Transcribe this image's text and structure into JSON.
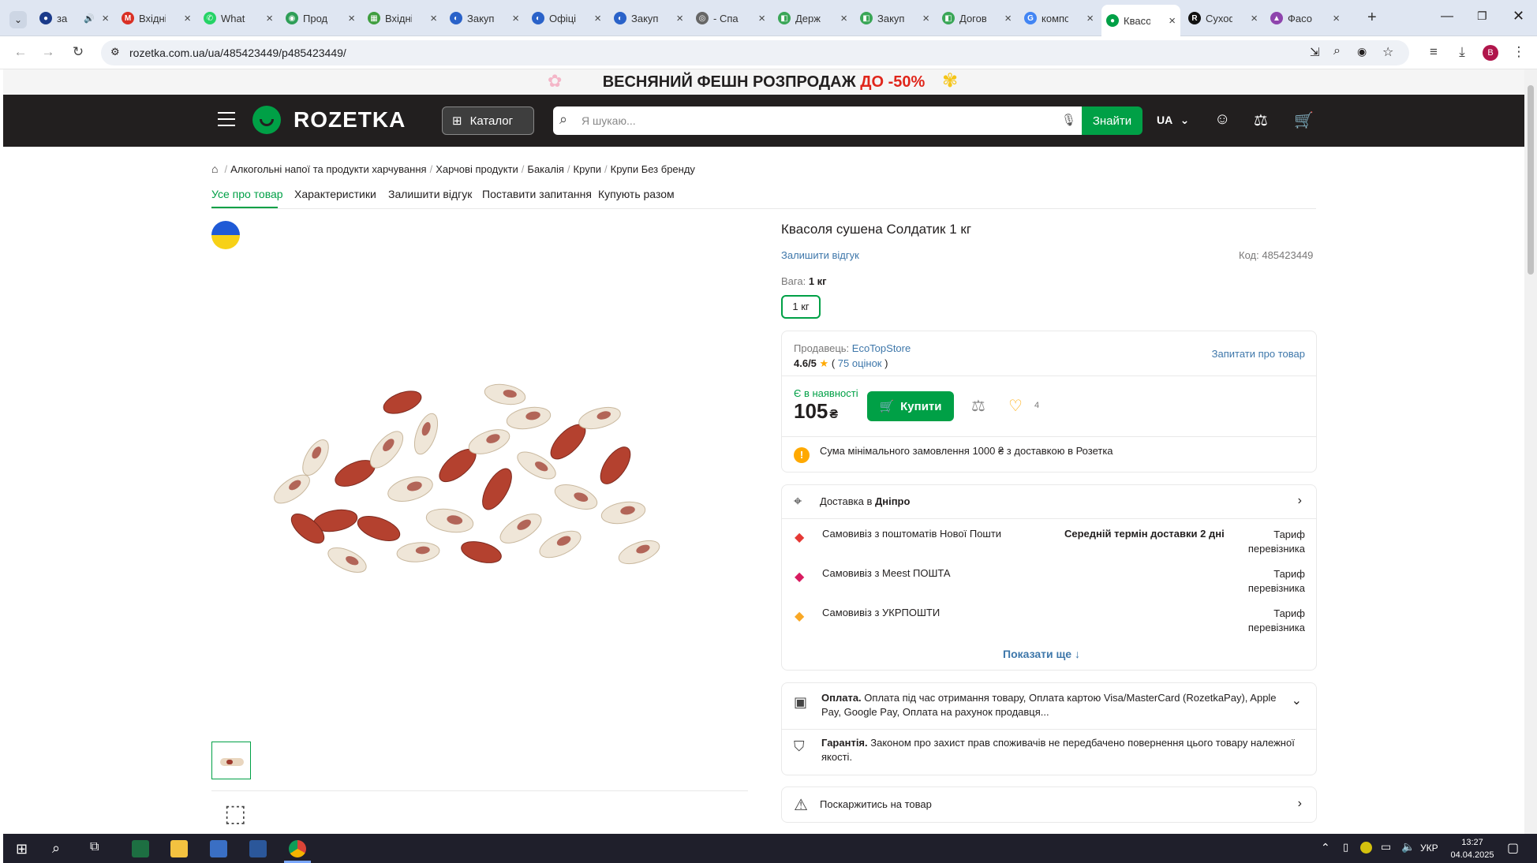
{
  "browser": {
    "tabs": [
      {
        "title": "за",
        "color": "#1a3a8a",
        "glyph": "●",
        "speaker": true
      },
      {
        "title": "Вхідні",
        "color": "#d93025",
        "glyph": "M"
      },
      {
        "title": "What",
        "color": "#25d366",
        "glyph": "✆"
      },
      {
        "title": "Прод",
        "color": "#2e9e57",
        "glyph": "◉"
      },
      {
        "title": "Вхідні",
        "color": "#3f9e3f",
        "glyph": "▦"
      },
      {
        "title": "Закуп",
        "color": "#2a62c9",
        "glyph": "◐"
      },
      {
        "title": "Офіці",
        "color": "#2a62c9",
        "glyph": "◐"
      },
      {
        "title": "Закуп",
        "color": "#2a62c9",
        "glyph": "◐"
      },
      {
        "title": "- Спа",
        "color": "#666",
        "glyph": "◎"
      },
      {
        "title": "Держ",
        "color": "#3aa657",
        "glyph": "◧"
      },
      {
        "title": "Закуп",
        "color": "#3aa657",
        "glyph": "◧"
      },
      {
        "title": "Догов",
        "color": "#3aa657",
        "glyph": "◧"
      },
      {
        "title": "компо",
        "color": "#4285f4",
        "glyph": "G"
      },
      {
        "title": "Квасо",
        "color": "#00a046",
        "glyph": "●",
        "active": true
      },
      {
        "title": "Сухоф",
        "color": "#111",
        "glyph": "R"
      },
      {
        "title": "Фасо",
        "color": "#8e44ad",
        "glyph": "▲"
      }
    ],
    "new_tab": "+",
    "url": "rozetka.com.ua/ua/485423449/p485423449/",
    "profile_letter": "B"
  },
  "promo": {
    "text": "ВЕСНЯНИЙ ФЕШН РОЗПРОДАЖ",
    "highlight": "ДО -50%"
  },
  "header": {
    "logo": "ROZETKA",
    "catalog": "Каталог",
    "search_placeholder": "Я шукаю...",
    "search_button": "Знайти",
    "lang": "UA"
  },
  "breadcrumbs": [
    "Алкогольні напої та продукти харчування",
    "Харчові продукти",
    "Бакалія",
    "Крупи",
    "Крупи Без бренду"
  ],
  "tabs": [
    "Усе про товар",
    "Характеристики",
    "Залишити відгук",
    "Поставити запитання",
    "Купують разом"
  ],
  "product": {
    "title": "Квасоля сушена Солдатик 1 кг",
    "review_link": "Залишити відгук",
    "code_label": "Код:",
    "code": "485423449",
    "weight_label": "Вага:",
    "weight_value": "1 кг",
    "weight_option": "1 кг",
    "seller_label": "Продавець:",
    "seller": "EcoTopStore",
    "rating": "4.6/5",
    "reviews": "75 оцінок",
    "ask": "Запитати про товар",
    "availability": "Є в наявності",
    "price": "105",
    "currency": "₴",
    "buy": "Купити",
    "wish_count": "4",
    "min_order": "Сума мінімального замовлення 1000 ₴ з доставкою в Розетка"
  },
  "delivery": {
    "label": "Доставка в",
    "city": "Дніпро",
    "options": [
      {
        "name": "Самовивіз з поштоматів Нової Пошти",
        "term": "Середній термін доставки 2 дні",
        "price": "Тариф перевізника",
        "color": "#e53935"
      },
      {
        "name": "Самовивіз з Meest ПОШТА",
        "term": "",
        "price": "Тариф перевізника",
        "color": "#d81b60"
      },
      {
        "name": "Самовивіз з УКРПОШТИ",
        "term": "",
        "price": "Тариф перевізника",
        "color": "#f9a825"
      }
    ],
    "more": "Показати ще"
  },
  "payment": {
    "title": "Оплата.",
    "text": "Оплата під час отримання товару, Оплата картою Visa/MasterCard (RozetkaPay), Apple Pay, Google Pay, Оплата на рахунок продавця..."
  },
  "warranty": {
    "title": "Гарантія.",
    "text": "Законом про захист прав споживачів не передбачено повернення цього товару належної якості."
  },
  "complain": "Поскаржитись на товар",
  "taskbar": {
    "lang": "УКР",
    "time": "13:27",
    "date": "04.04.2025"
  }
}
